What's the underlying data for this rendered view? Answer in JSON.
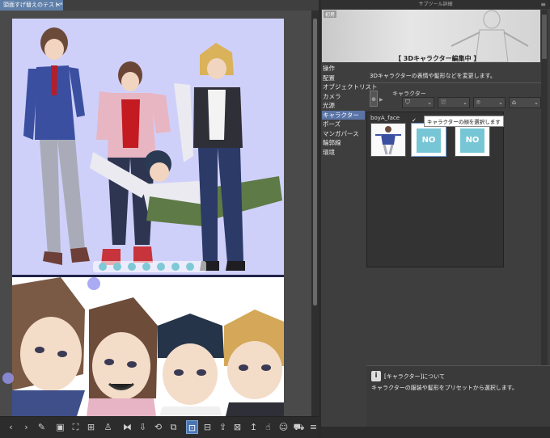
{
  "document": {
    "tab_title": "頭面すげ替えのテスト*",
    "close_icon": "close-icon"
  },
  "canvas": {
    "panel1_bg": "#cfd0fa",
    "panel2_bg": "#ffffff"
  },
  "bottom_toolbar": {
    "buttons": [
      {
        "name": "prev-icon",
        "glyph": "‹"
      },
      {
        "name": "next-icon",
        "glyph": "›"
      },
      {
        "name": "wrench-icon",
        "glyph": "✎"
      },
      {
        "name": "camera-icon",
        "glyph": "▣"
      },
      {
        "name": "frame-icon",
        "glyph": "⛶"
      },
      {
        "name": "ground-icon",
        "glyph": "⊞"
      },
      {
        "name": "walk-icon",
        "glyph": "♙"
      },
      {
        "name": "flip-icon",
        "glyph": "⧓"
      },
      {
        "name": "download-icon",
        "glyph": "⇩"
      },
      {
        "name": "reset-icon",
        "glyph": "⟲"
      },
      {
        "name": "fit-icon",
        "glyph": "⧉"
      },
      {
        "name": "pose-icon",
        "glyph": "⊡"
      },
      {
        "name": "body-icon",
        "glyph": "⊟"
      },
      {
        "name": "save-icon",
        "glyph": "⇪"
      },
      {
        "name": "lock-icon",
        "glyph": "⊠"
      },
      {
        "name": "arrow-icon",
        "glyph": "↥"
      },
      {
        "name": "hand-icon",
        "glyph": "☝"
      },
      {
        "name": "face-icon",
        "glyph": "☺"
      },
      {
        "name": "car-icon",
        "glyph": "⛟"
      },
      {
        "name": "menu-icon",
        "glyph": "≡"
      }
    ]
  },
  "sub_tool": {
    "title": "サブツール詳細",
    "menu_glyph": "≡",
    "preview_label": "初男",
    "mode_label": "【 3Dキャラクター編集中 】",
    "categories": [
      {
        "label": "操作",
        "selected": false
      },
      {
        "label": "配置",
        "selected": false
      },
      {
        "label": "オブジェクトリスト",
        "selected": false
      },
      {
        "label": "カメラ",
        "selected": false
      },
      {
        "label": "光源",
        "selected": false
      },
      {
        "label": "キャラクター",
        "selected": true
      },
      {
        "label": "ポーズ",
        "selected": false
      },
      {
        "label": "マンガパース",
        "selected": false
      },
      {
        "label": "輪郭線",
        "selected": false
      },
      {
        "label": "環境",
        "selected": false
      }
    ],
    "description": "3Dキャラクターの表情や髪形などを変更します。",
    "character_label": "キャラクター",
    "category_buttons": [
      {
        "name": "body-category-button",
        "glyph": "⛉"
      },
      {
        "name": "hair-category-button",
        "glyph": "⛆"
      },
      {
        "name": "head-category-button",
        "glyph": "⌾"
      },
      {
        "name": "accessory-category-button",
        "glyph": "⌂"
      }
    ],
    "preset_header": "boyA_face",
    "preset_check": "✓",
    "tooltip": "キャラクターの顔を選択します",
    "presets": [
      {
        "name": "boyA_face",
        "no_image": false
      },
      {
        "name": "NO image",
        "no_image": true
      },
      {
        "name": "NO image",
        "no_image": true
      }
    ],
    "no_image_text": "NO",
    "info_title": "[キャラクター]について",
    "info_body": "キャラクターの服装や髪形をプリセットから選択します。",
    "info_icon": "i"
  },
  "colors": {
    "accent": "#5a74a6",
    "active_tool": "#4c76b2"
  }
}
